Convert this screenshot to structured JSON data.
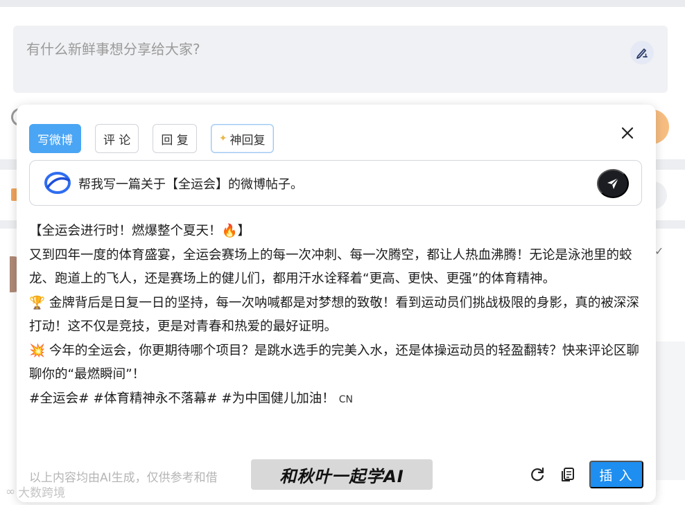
{
  "compose": {
    "placeholder": "有什么新鲜事想分享给大家?",
    "icon": "pen-write-icon"
  },
  "popup": {
    "tabs": [
      {
        "label": "写微博",
        "active": true
      },
      {
        "label": "评 论",
        "active": false
      },
      {
        "label": "回 复",
        "active": false
      },
      {
        "label": "神回复",
        "active": false,
        "icon": "sparkle-icon"
      }
    ],
    "close_icon": "close-icon",
    "prompt": {
      "text": "帮我写一篇关于【全运会】的微博帖子。",
      "logo_icon": "ai-ring-logo-icon",
      "send_icon": "send-arrow-icon"
    },
    "result": {
      "title": "【全运会进行时！燃爆整个夏天！🔥】",
      "para1": "又到四年一度的体育盛宴，全运会赛场上的每一次冲刺、每一次腾空，都让人热血沸腾！无论是泳池里的蛟龙、跑道上的飞人，还是赛场上的健儿们，都用汗水诠释着“更高、更快、更强”的体育精神。",
      "para2": "🏆 金牌背后是日复一日的坚持，每一次呐喊都是对梦想的致敬！看到运动员们挑战极限的身影，真的被深深打动！这不仅是竞技，更是对青春和热爱的最好证明。",
      "para3": "💥 今年的全运会，你更期待哪个项目？是跳水选手的完美入水，还是体操运动员的轻盈翻转？快来评论区聊聊你的“最燃瞬间”！",
      "hashtags": "#全运会# #体育精神永不落幕# #为中国健儿加油！",
      "hashtag_suffix": "CN"
    },
    "footer_note": "以上内容均由AI生成，仅供参考和借",
    "watermark": "和秋叶一起学AI",
    "actions": {
      "refresh_icon": "refresh-icon",
      "copy_icon": "copy-icon",
      "insert_label": "插 入"
    }
  },
  "corner_mark": "大数跨境",
  "colors": {
    "primary_blue": "#1e8ef0",
    "tab_active": "#4aa5f4",
    "send_button": "#1b1d22"
  }
}
